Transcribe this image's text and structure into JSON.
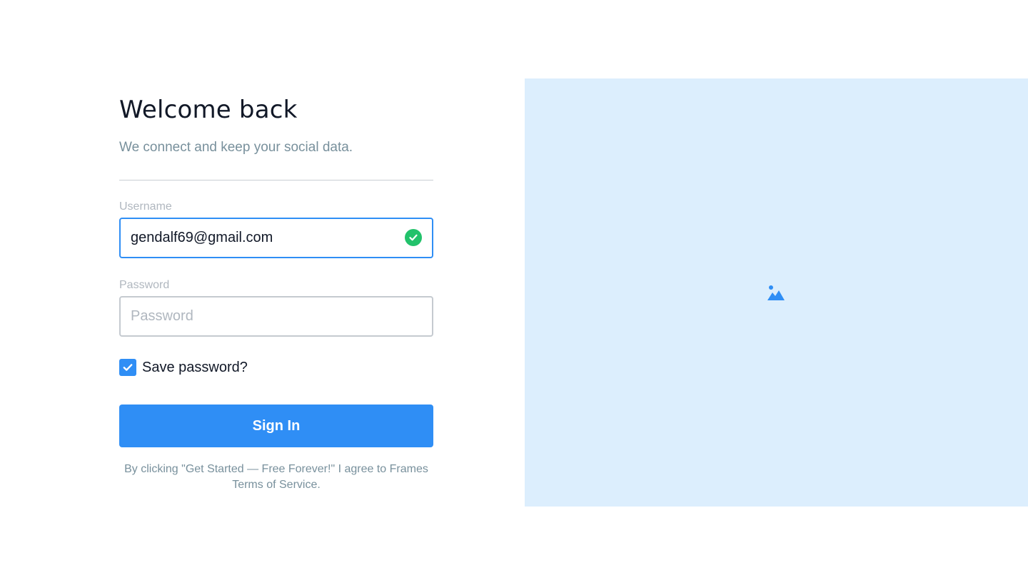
{
  "login": {
    "title": "Welcome back",
    "subtitle": "We connect and keep your social data.",
    "username": {
      "label": "Username",
      "value": "gendalf69@gmail.com",
      "valid": true
    },
    "password": {
      "label": "Password",
      "value": "",
      "placeholder": "Password"
    },
    "save_password": {
      "label": "Save password?",
      "checked": true
    },
    "submit_label": "Sign In",
    "terms_line1": "By clicking \"Get Started — Free Forever!\" I agree to Frames",
    "terms_line2": "Terms of Service."
  },
  "image_panel": {
    "icon": "image-placeholder-icon"
  },
  "colors": {
    "accent": "#2f8ef5",
    "success": "#22c26b",
    "panel_background": "#dceefd",
    "muted_text": "#78909c",
    "label_text": "#b0b7bf"
  }
}
